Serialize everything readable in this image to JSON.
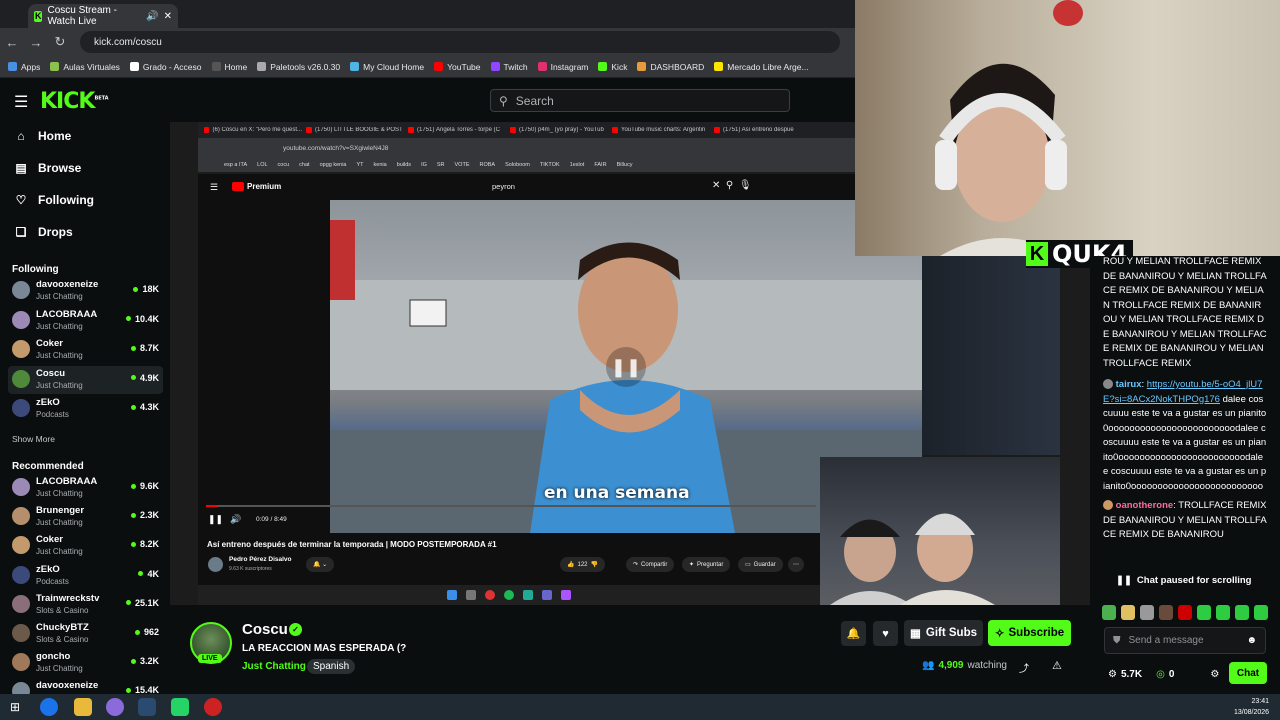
{
  "browser": {
    "tab_title": "Coscu Stream - Watch Live",
    "address": "kick.com/coscu",
    "bookmarks": [
      "Apps",
      "Aulas Virtuales",
      "Grado - Acceso",
      "Home",
      "Paletools v26.0.30",
      "My Cloud Home",
      "YouTube",
      "Twitch",
      "Instagram",
      "Kick",
      "DASHBOARD",
      "Mercado Libre Arge..."
    ]
  },
  "kick": {
    "logo": "KICK",
    "logo_beta": "BETA",
    "search_placeholder": "Search",
    "nav": [
      {
        "label": "Home",
        "icon": "home-icon"
      },
      {
        "label": "Browse",
        "icon": "browse-icon"
      },
      {
        "label": "Following",
        "icon": "heart-icon"
      },
      {
        "label": "Drops",
        "icon": "drops-icon"
      }
    ],
    "following_header": "Following",
    "following": [
      {
        "name": "davooxeneize",
        "category": "Just Chatting",
        "viewers": "18K",
        "color": "#7a8796"
      },
      {
        "name": "LACOBRAAA",
        "category": "Just Chatting",
        "viewers": "10.4K",
        "color": "#9b8ab5"
      },
      {
        "name": "Coker",
        "category": "Just Chatting",
        "viewers": "8.7K",
        "color": "#c29a6b"
      },
      {
        "name": "Coscu",
        "category": "Just Chatting",
        "viewers": "4.9K",
        "color": "#4e8a3a"
      },
      {
        "name": "zEkO",
        "category": "Podcasts",
        "viewers": "4.3K",
        "color": "#3b4a7a"
      }
    ],
    "show_more": "Show More",
    "recommended_header": "Recommended",
    "recommended": [
      {
        "name": "LACOBRAAA",
        "category": "Just Chatting",
        "viewers": "9.6K",
        "color": "#9b8ab5"
      },
      {
        "name": "Brunenger",
        "category": "Just Chatting",
        "viewers": "2.3K",
        "color": "#b58f6b"
      },
      {
        "name": "Coker",
        "category": "Just Chatting",
        "viewers": "8.2K",
        "color": "#c29a6b"
      },
      {
        "name": "zEkO",
        "category": "Podcasts",
        "viewers": "4K",
        "color": "#3b4a7a"
      },
      {
        "name": "Trainwreckstv",
        "category": "Slots & Casino",
        "viewers": "25.1K",
        "color": "#8a6f7a"
      },
      {
        "name": "ChuckyBTZ",
        "category": "Slots & Casino",
        "viewers": "962",
        "color": "#6b5a4a"
      },
      {
        "name": "goncho",
        "category": "Just Chatting",
        "viewers": "3.2K",
        "color": "#a0785a"
      },
      {
        "name": "davooxeneize",
        "category": "",
        "viewers": "15.4K",
        "color": "#7a8796"
      }
    ]
  },
  "youtube": {
    "inner_tabs": [
      "(6) Coscu en X: \"Pero me quest...",
      "(1750) LITTLE BOOGIE & POST",
      "(1751) Ángela Torres - torpe (C",
      "(1750) p4m_ (yo pray) - YouTub",
      "YouTube music charts: Argentin",
      "(1751) Así entreno despué"
    ],
    "inner_address": "youtube.com/watch?v=SXgiwleN4J8",
    "inner_bookmarks": [
      "esp a ITA",
      "LOL",
      "cocu",
      "chat",
      "opgg kenia",
      "YT",
      "kenia",
      "builds",
      "IG",
      "SR",
      "VOTE",
      "ROBA",
      "Soloboom",
      "TIKTOK",
      "1eslot",
      "FAIR",
      "Billucy"
    ],
    "premium": "Premium",
    "query": "peyron",
    "caption": "en una semana",
    "time": "0:09 / 8:49",
    "title": "Así entreno después de terminar la temporada | MODO POSTEMPORADA #1",
    "channel": "Pedro Pérez Disalvo",
    "subs": "9.63 K suscriptores",
    "likes": "122",
    "share": "Compartir",
    "ask": "Preguntar",
    "save": "Guardar",
    "progress": 0.018
  },
  "overlay": {
    "quk4": "QUK4"
  },
  "chat": {
    "messages": [
      {
        "user": "",
        "text": "ROU Y MELIAN TROLLFACE REMIX DE BANANIROU Y MELIAN TROLLFACE REMIX DE BANANIROU Y MELIAN TROLLFACE REMIX DE BANANIROU Y MELIAN TROLLFACE REMIX DE BANANIROU Y MELIAN TROLLFACE REMIX DE BANANIROU Y MELIAN TROLLFACE REMIX"
      },
      {
        "user": "tairux",
        "link": "https://youtu.be/5-oO4_jlU7E?si=8ACx2NokTHPOg176",
        "text": "dalee coscuuuu este te va a gustar es un pianito0oooooooooooooooooooooooodalee coscuuuu este te va a gustar es un pianito0oooooooooooooooooooooooodalee coscuuuu este te va a gustar es un pianito0ooooooooooooooooooooooooo"
      },
      {
        "user": "oanotherone",
        "text": "TROLLFACE REMIX DE BANANIROU Y MELIAN TROLLFACE REMIX DE BANANIROU"
      }
    ],
    "paused": "Chat paused for scrolling",
    "send_placeholder": "Send a message",
    "kicks": "5.7K",
    "points": "0",
    "chat_button": "Chat"
  },
  "streamer": {
    "name": "Coscu",
    "live": "LIVE",
    "title": "LA REACCION MAS ESPERADA (?",
    "category": "Just Chatting",
    "language": "Spanish",
    "gift": "Gift Subs",
    "subscribe": "Subscribe",
    "watchers": "4,909",
    "watching_label": "watching"
  },
  "os": {
    "time": "23:41",
    "date": "13/08/2026"
  },
  "colors": {
    "kick_green": "#53fc18",
    "bg": "#0b0e0f"
  }
}
